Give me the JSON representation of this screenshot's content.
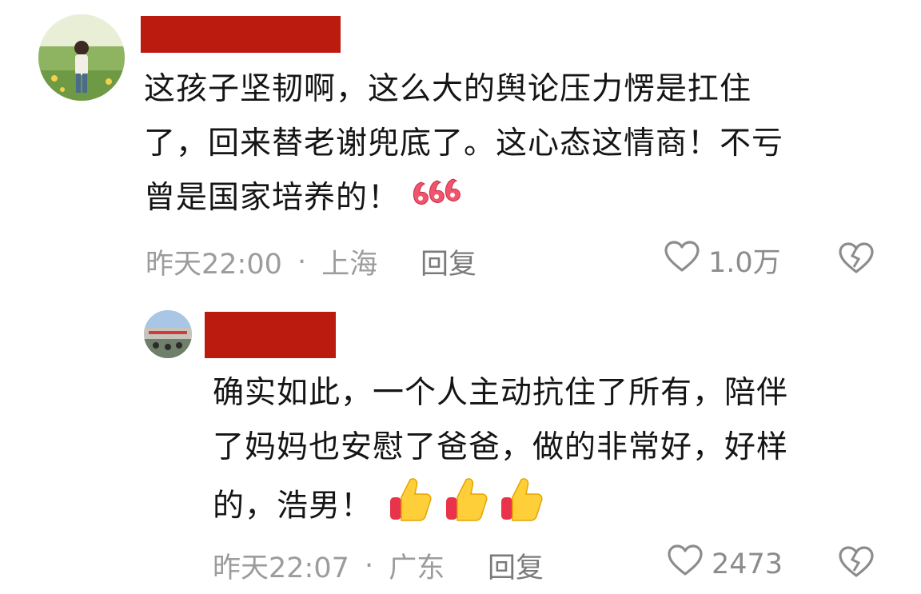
{
  "comments": [
    {
      "text_lines": [
        "这孩子坚韧啊，这么大的舆论压力愣是扛住",
        "了，回来替老谢兜底了。这心态这情商！不亏",
        "曾是国家培养的！"
      ],
      "sticker": "666-sticker",
      "time": "昨天22:00",
      "separator": "·",
      "location": "上海",
      "reply_label": "回复",
      "likes": "1.0万"
    },
    {
      "text_lines": [
        "确实如此，一个人主动抗住了所有，陪伴",
        "了妈妈也安慰了爸爸，做的非常好，好样",
        "的，浩男！"
      ],
      "sticker": "thumbs-up-icon",
      "time": "昨天22:07",
      "separator": "·",
      "location": "广东",
      "reply_label": "回复",
      "likes": "2473"
    }
  ],
  "colors": {
    "redaction": "#bb1a0e",
    "meta_text": "#9c9c9c",
    "body_text": "#151515",
    "icon_stroke": "#8c8c8c"
  }
}
